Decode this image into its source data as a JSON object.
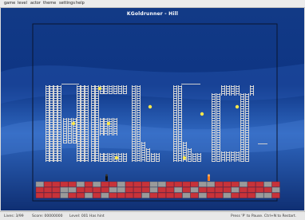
{
  "menu": {
    "items": [
      "game",
      "level",
      "actor",
      "theme",
      "settings",
      "help"
    ]
  },
  "game": {
    "title": "KGoldrunner - Hill"
  },
  "status": {
    "lives": "Lives: 3/99",
    "score": "Score: 00000000",
    "level": "Level: 001",
    "hint": "Has hint",
    "right": "Press 'P' to Pause. Ctrl+N to Restart."
  },
  "colors": {
    "background": "#0f347f",
    "border": "#0a1530",
    "ladder": "#d6d6d6",
    "gold": "#ffe84a",
    "brick_red": "#c7333a",
    "brick_gray": "#9a9a9a"
  },
  "icons": [
    "hero-icon",
    "enemy-icon",
    "gold-icon"
  ]
}
